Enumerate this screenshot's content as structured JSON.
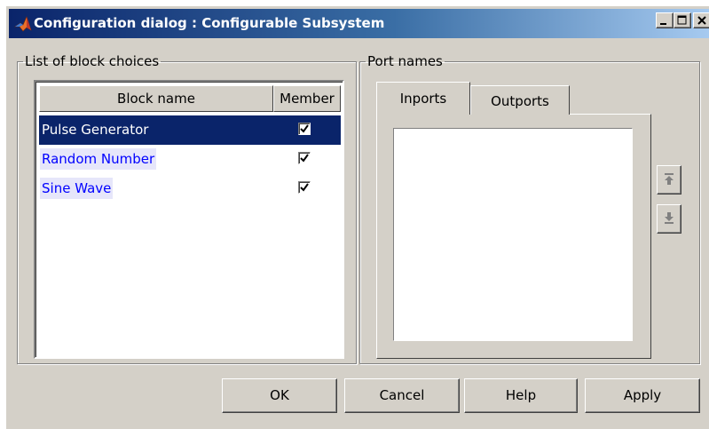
{
  "window": {
    "title": "Configuration dialog : Configurable Subsystem",
    "icon": "matlab-logo-icon",
    "controls": [
      "minimize-icon",
      "maximize-icon",
      "close-icon"
    ]
  },
  "block_choices": {
    "legend": "List of block choices",
    "columns": [
      "Block name",
      "Member"
    ],
    "rows": [
      {
        "name": "Pulse Generator",
        "member": true,
        "selected": true
      },
      {
        "name": "Random Number",
        "member": true,
        "selected": false
      },
      {
        "name": "Sine Wave",
        "member": true,
        "selected": false
      }
    ]
  },
  "port_names": {
    "legend": "Port names",
    "tabs": [
      {
        "label": "Inports",
        "active": true
      },
      {
        "label": "Outports",
        "active": false
      }
    ],
    "move_up_icon": "move-up-icon",
    "move_down_icon": "move-down-icon"
  },
  "buttons": {
    "ok": "OK",
    "cancel": "Cancel",
    "help": "Help",
    "apply": "Apply"
  },
  "colors": {
    "selection": "#0a246a",
    "title_gradient_start": "#0a246a",
    "title_gradient_end": "#a6caf0",
    "link_text": "#0000ff",
    "face": "#d4d0c8"
  }
}
